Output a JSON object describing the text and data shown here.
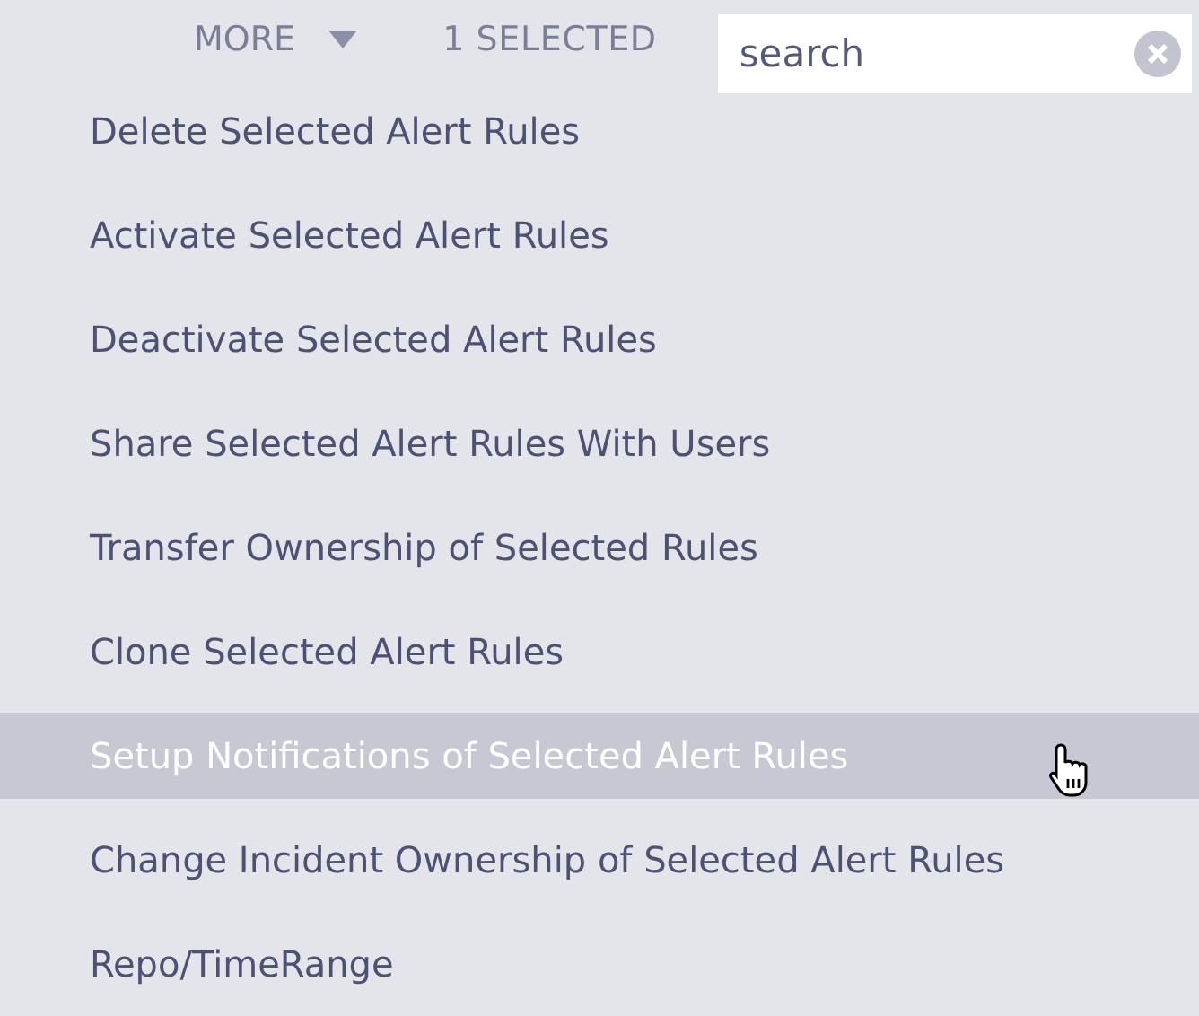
{
  "toolbar": {
    "more_label": "MORE",
    "selected_count": "1 SELECTED",
    "search": {
      "placeholder": "search"
    }
  },
  "menu": [
    {
      "label": "Delete Selected Alert Rules",
      "highlighted": false
    },
    {
      "label": "Activate Selected Alert Rules",
      "highlighted": false
    },
    {
      "label": "Deactivate Selected Alert Rules",
      "highlighted": false
    },
    {
      "label": "Share Selected Alert Rules With Users",
      "highlighted": false
    },
    {
      "label": "Transfer Ownership of Selected Rules",
      "highlighted": false
    },
    {
      "label": "Clone Selected Alert Rules",
      "highlighted": false
    },
    {
      "label": "Setup Notifications of Selected Alert Rules",
      "highlighted": true
    },
    {
      "label": "Change Incident Ownership of Selected Alert Rules",
      "highlighted": false
    },
    {
      "label": "Repo/TimeRange",
      "highlighted": false
    }
  ]
}
